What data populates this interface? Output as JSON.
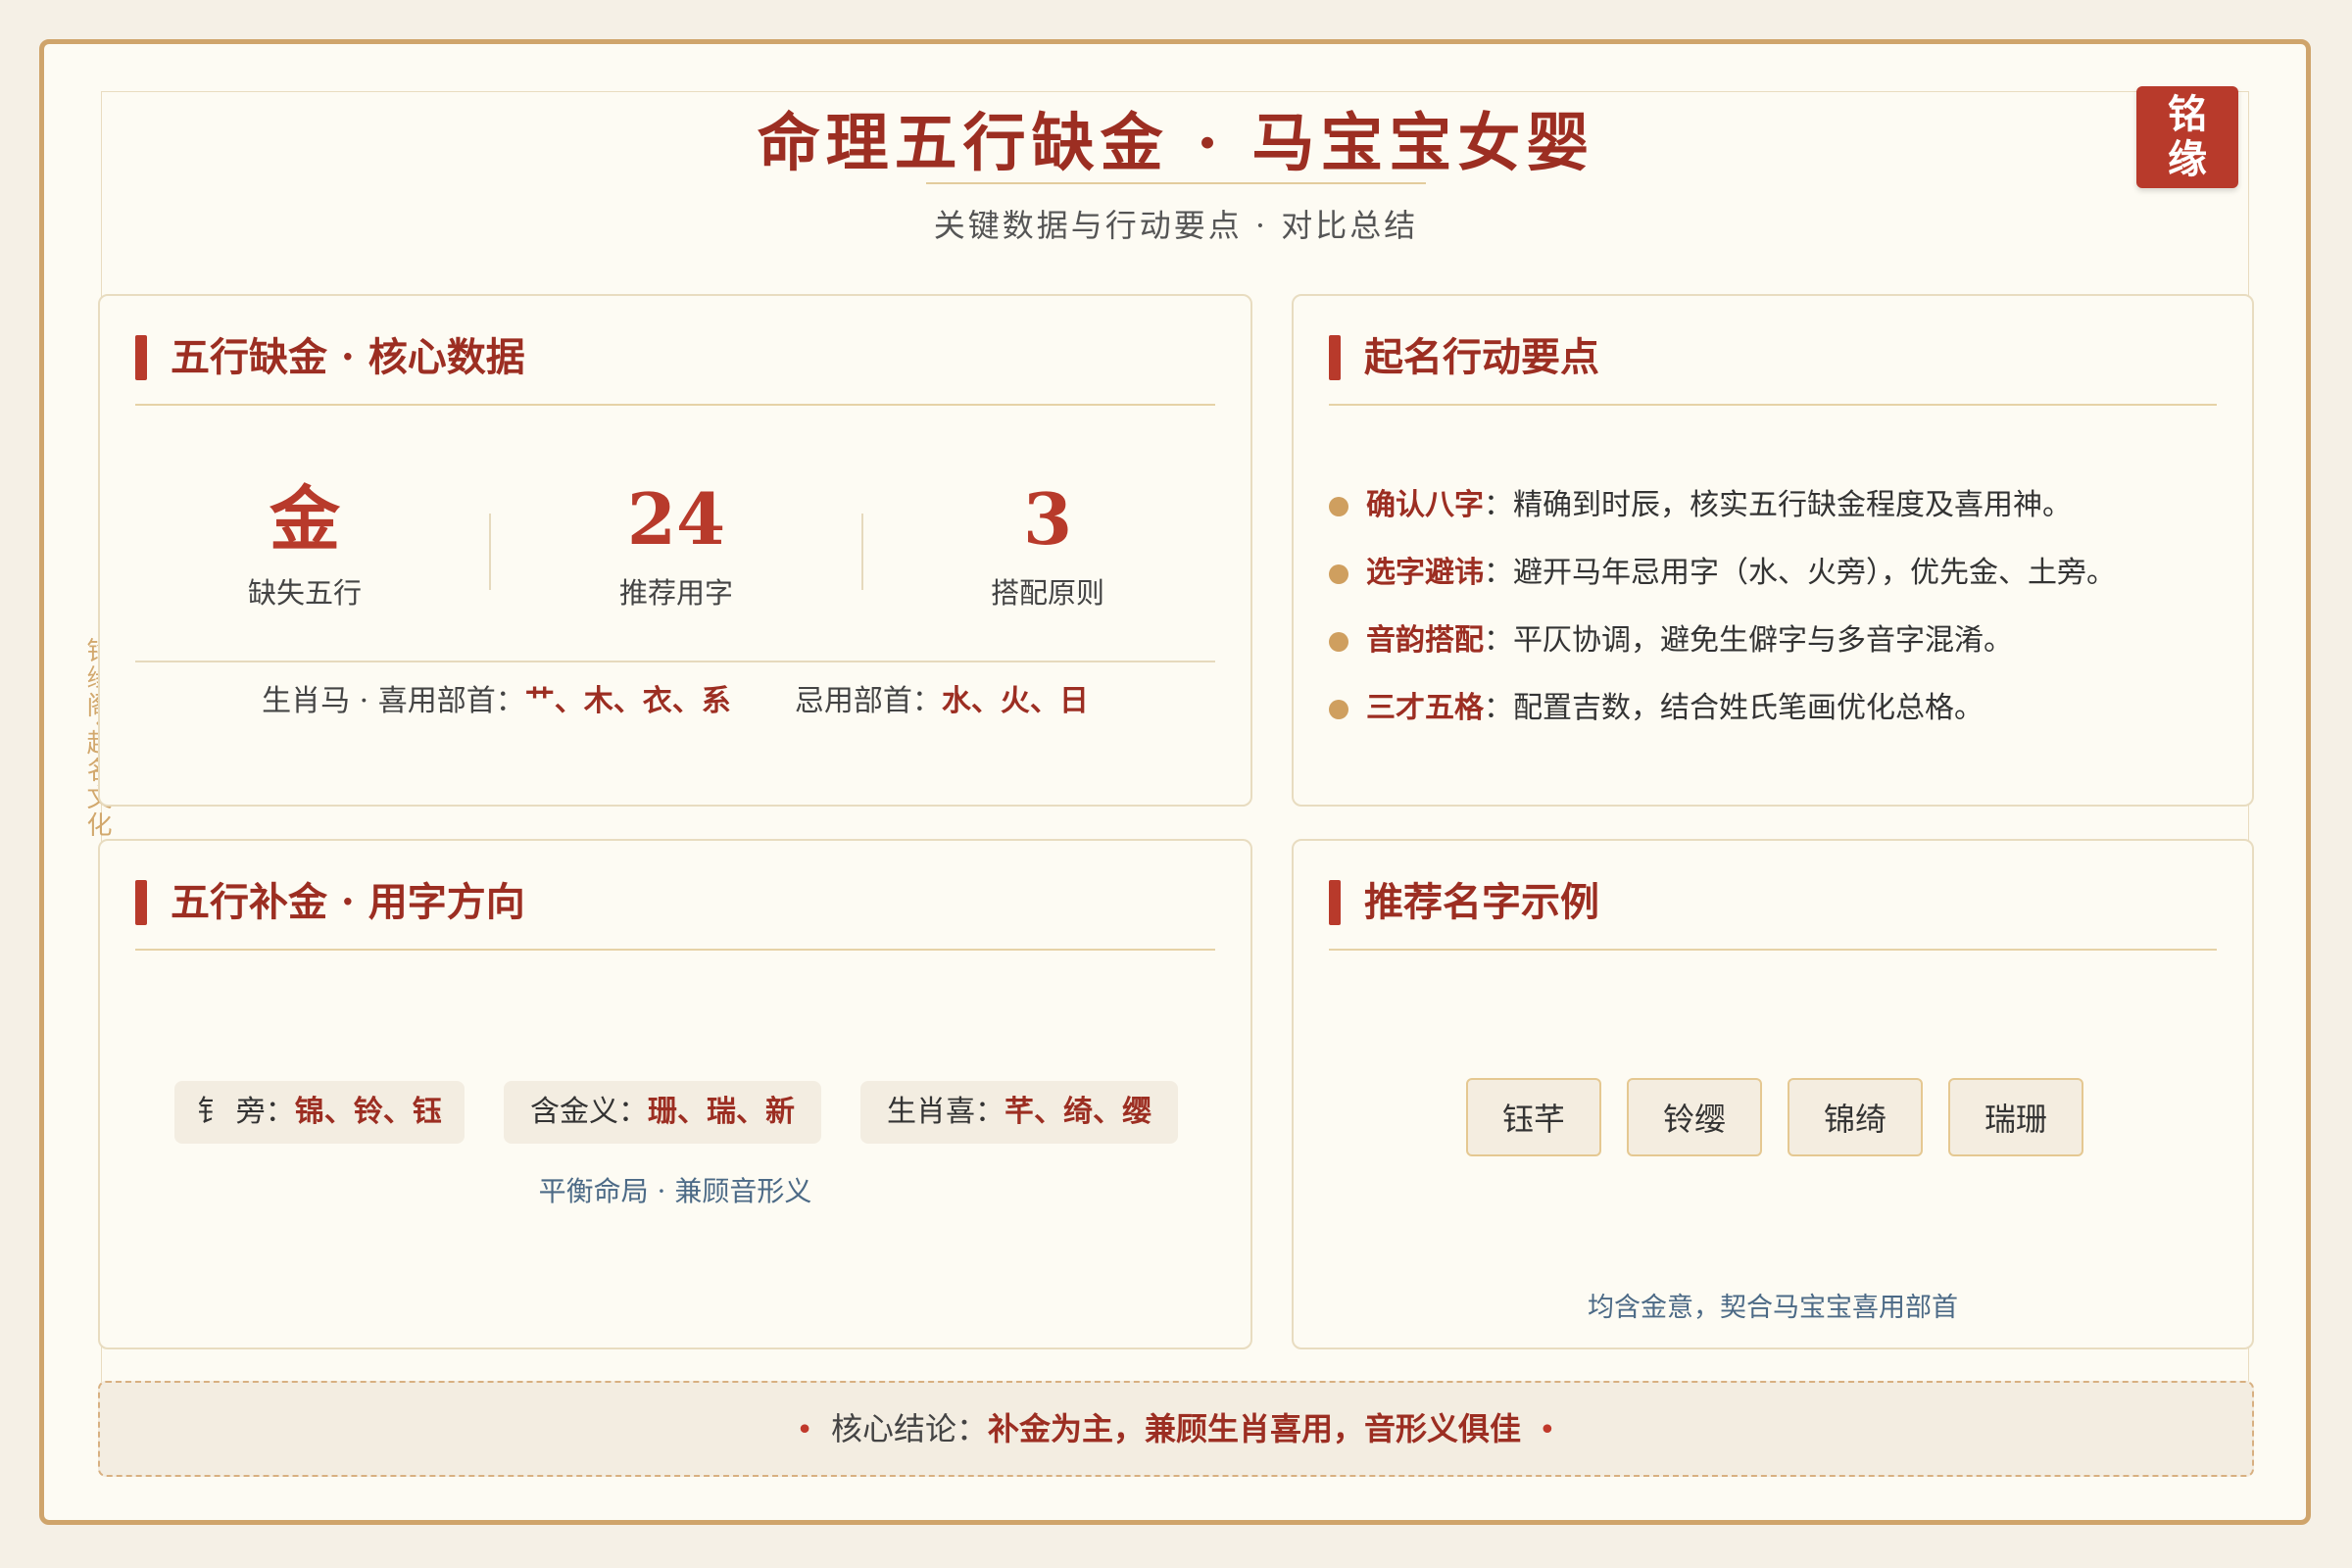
{
  "header": {
    "title": "命理五行缺金 · 马宝宝女婴",
    "subtitle": "关键数据与行动要点 · 对比总结",
    "seal_line1": "铭",
    "seal_line2": "缘"
  },
  "side_label": "铭缘阁·起名文化",
  "core_card": {
    "heading": "五行缺金 · 核心数据",
    "stats": [
      {
        "value": "金",
        "label": "缺失五行"
      },
      {
        "value": "24",
        "label": "推荐用字"
      },
      {
        "value": "3",
        "label": "搭配原则"
      }
    ],
    "favorable_label": "生肖马 · 喜用部首：",
    "favorable_value": "艹、木、衣、系",
    "avoid_label": "忌用部首：",
    "avoid_value": "水、火、日"
  },
  "action_card": {
    "heading": "起名行动要点",
    "points": [
      {
        "key": "确认八字",
        "text": "：精确到时辰，核实五行缺金程度及喜用神。"
      },
      {
        "key": "选字避讳",
        "text": "：避开马年忌用字（水、火旁），优先金、土旁。"
      },
      {
        "key": "音韵搭配",
        "text": "：平仄协调，避免生僻字与多音字混淆。"
      },
      {
        "key": "三才五格",
        "text": "：配置吉数，结合姓氏笔画优化总格。"
      }
    ]
  },
  "direction_card": {
    "heading": "五行补金 · 用字方向",
    "chips": [
      {
        "label": "钅 旁：",
        "value": "锦、铃、钰"
      },
      {
        "label": "含金义：",
        "value": "珊、瑞、新"
      },
      {
        "label": "生肖喜：",
        "value": "芊、绮、缨"
      }
    ],
    "note": "平衡命局 · 兼顾音形义"
  },
  "names_card": {
    "heading": "推荐名字示例",
    "names": [
      "钰芊",
      "铃缨",
      "锦绮",
      "瑞珊"
    ],
    "note": "均含金意，契合马宝宝喜用部首"
  },
  "conclusion": {
    "label": "核心结论：",
    "text": "补金为主，兼顾生肖喜用，音形义俱佳"
  },
  "colors": {
    "primary_red": "#9c2e22",
    "accent_red": "#b83a2b",
    "gold": "#cfa46b",
    "background": "#fdfbf3"
  }
}
